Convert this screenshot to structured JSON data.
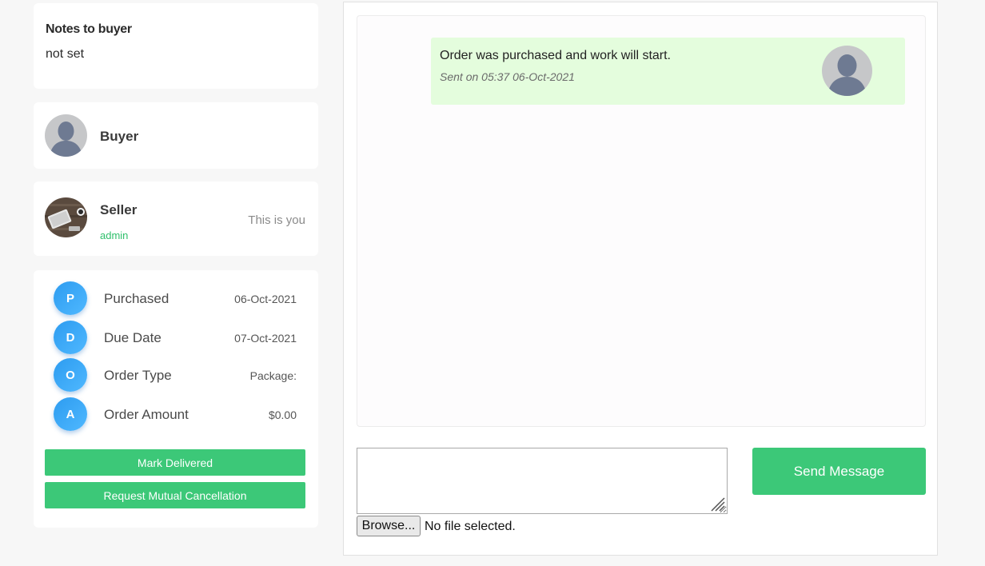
{
  "notes": {
    "title": "Notes to buyer",
    "value": "not set"
  },
  "buyer": {
    "label": "Buyer",
    "avatar_icon": "person-silhouette-icon"
  },
  "seller": {
    "label": "Seller",
    "username": "admin",
    "note": "This is you",
    "avatar_icon": "desk-photo-avatar"
  },
  "order_details": [
    {
      "badge": "P",
      "label": "Purchased",
      "value": "06-Oct-2021"
    },
    {
      "badge": "D",
      "label": "Due Date",
      "value": "07-Oct-2021"
    },
    {
      "badge": "O",
      "label": "Order Type",
      "value": "Package:"
    },
    {
      "badge": "A",
      "label": "Order Amount",
      "value": "$0.00"
    }
  ],
  "actions": {
    "mark_delivered": "Mark Delivered",
    "mutual_cancel": "Request Mutual Cancellation"
  },
  "messages": [
    {
      "text": "Order was purchased and work will start.",
      "time": "Sent on 05:37 06-Oct-2021"
    }
  ],
  "composer": {
    "input_value": "",
    "send_label": "Send Message",
    "browse_label": "Browse...",
    "file_status": "No file selected."
  },
  "colors": {
    "accent_green": "#3cc878",
    "badge_blue": "#2d9cf0",
    "bubble_green": "#e4fddd",
    "username_green": "#2fbf6b"
  }
}
